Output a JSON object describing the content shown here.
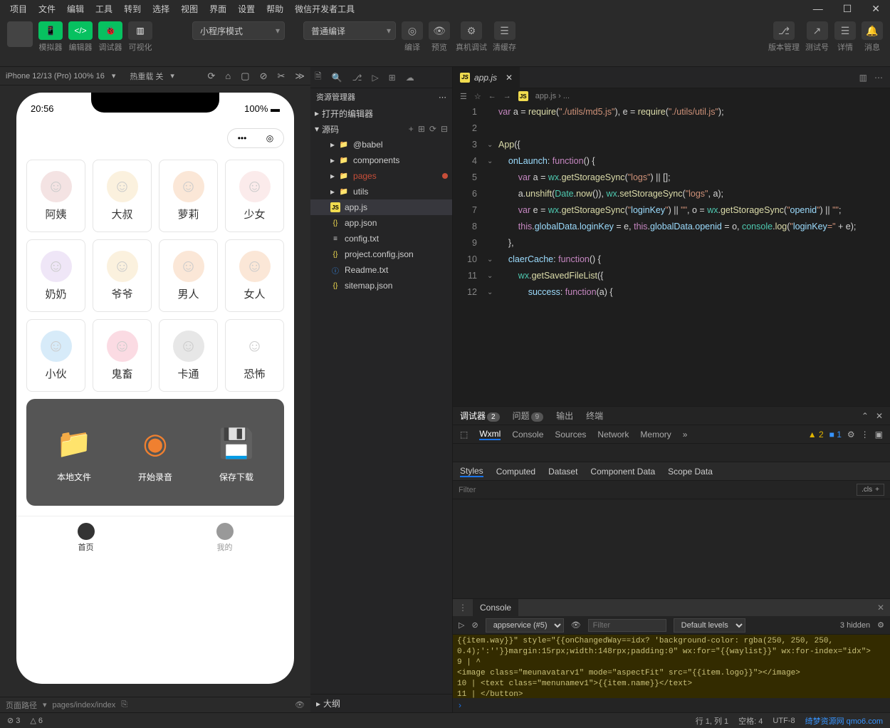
{
  "menubar": [
    "项目",
    "文件",
    "编辑",
    "工具",
    "转到",
    "选择",
    "视图",
    "界面",
    "设置",
    "帮助",
    "微信开发者工具"
  ],
  "toolbar": {
    "modes": [
      "模拟器",
      "编辑器",
      "调试器",
      "可视化"
    ],
    "select1": "小程序模式",
    "select2": "普通编译",
    "mid_icons": [
      "编译",
      "预览",
      "真机调试",
      "清缓存"
    ],
    "right_icons": [
      "版本管理",
      "测试号",
      "详情",
      "消息"
    ]
  },
  "devbar": {
    "device": "iPhone 12/13 (Pro) 100% 16",
    "hot": "热重载 关"
  },
  "simulator": {
    "time": "20:56",
    "battery": "100%",
    "cards": [
      [
        "阿姨",
        "#d48f8f"
      ],
      [
        "大叔",
        "#f0c77a"
      ],
      [
        "萝莉",
        "#f0a060"
      ],
      [
        "少女",
        "#f0b0b0"
      ],
      [
        "奶奶",
        "#c19ae0"
      ],
      [
        "爷爷",
        "#f0c77a"
      ],
      [
        "男人",
        "#f0a060"
      ],
      [
        "女人",
        "#f0a060"
      ],
      [
        "小伙",
        "#60b0e8"
      ],
      [
        "鬼畜",
        "#f07090"
      ],
      [
        "卡通",
        "#a0a0a0"
      ],
      [
        "恐怖",
        "#000"
      ]
    ],
    "actions": [
      "本地文件",
      "开始录音",
      "保存下载"
    ],
    "tabs": [
      "首页",
      "我的"
    ]
  },
  "statusline": {
    "path_label": "页面路径",
    "path": "pages/index/index"
  },
  "explorer": {
    "title": "资源管理器",
    "sec1": "打开的编辑器",
    "sec2": "源码",
    "folders": [
      "@babel",
      "components",
      "pages",
      "utils"
    ],
    "files": [
      [
        "app.js",
        "js"
      ],
      [
        "app.json",
        "json"
      ],
      [
        "config.txt",
        "txt"
      ],
      [
        "project.config.json",
        "json"
      ],
      [
        "Readme.txt",
        "info"
      ],
      [
        "sitemap.json",
        "json"
      ]
    ],
    "outline": "大纲"
  },
  "editor": {
    "tab": "app.js",
    "breadcrumb": "app.js › ...",
    "lines": [
      "var a = require(\"./utils/md5.js\"), e = require(\"./utils/util.js\");",
      "",
      "App({",
      "    onLaunch: function() {",
      "        var a = wx.getStorageSync(\"logs\") || [];",
      "        a.unshift(Date.now()), wx.setStorageSync(\"logs\", a);",
      "        var e = wx.getStorageSync(\"loginKey\") || \"\", o = wx.getStorageSync(\"openid\") || \"\";",
      "        this.globalData.loginKey = e, this.globalData.openid = o, console.log(\"loginKey=\" + e);",
      "    },",
      "    claerCache: function() {",
      "        wx.getSavedFileList({",
      "            success: function(a) {"
    ]
  },
  "dt": {
    "tabs": [
      "调试器",
      "问题",
      "输出",
      "终端"
    ],
    "badge1": "2",
    "badge2": "9",
    "toolbar": [
      "Wxml",
      "Console",
      "Sources",
      "Network",
      "Memory"
    ],
    "warn": "▲ 2",
    "info": "■ 1",
    "styles_tabs": [
      "Styles",
      "Computed",
      "Dataset",
      "Component Data",
      "Scope Data"
    ],
    "filter": "Filter",
    "cls": ".cls"
  },
  "console": {
    "title": "Console",
    "context": "appservice (#5)",
    "filter": "Filter",
    "levels": "Default levels",
    "hidden": "3 hidden",
    "lines": [
      "{{item.way}}\"  style=\"{{onChangedWay==idx? 'background-color: rgba(250, 250, 250, 0.4);':''}}margin:15rpx;width:148rpx;padding:0\" wx:for=\"{{waylist}}\" wx:for-index=\"idx\">",
      "    9 |                 ^",
      "                         <image class=\"meunavatarv1\" mode=\"aspectFit\" src=\"{{item.logo}}\"></image>",
      "   10 |                 <text class=\"menunamev1\">{{item.name}}</text>",
      "   11 |             </button>"
    ]
  },
  "footer": {
    "err": "⊘ 3",
    "warn": "△ 6",
    "pos": "行 1, 列 1",
    "space": "空格: 4",
    "enc": "UTF-8",
    "watermark": "绮梦资源网 qmo6.com"
  }
}
